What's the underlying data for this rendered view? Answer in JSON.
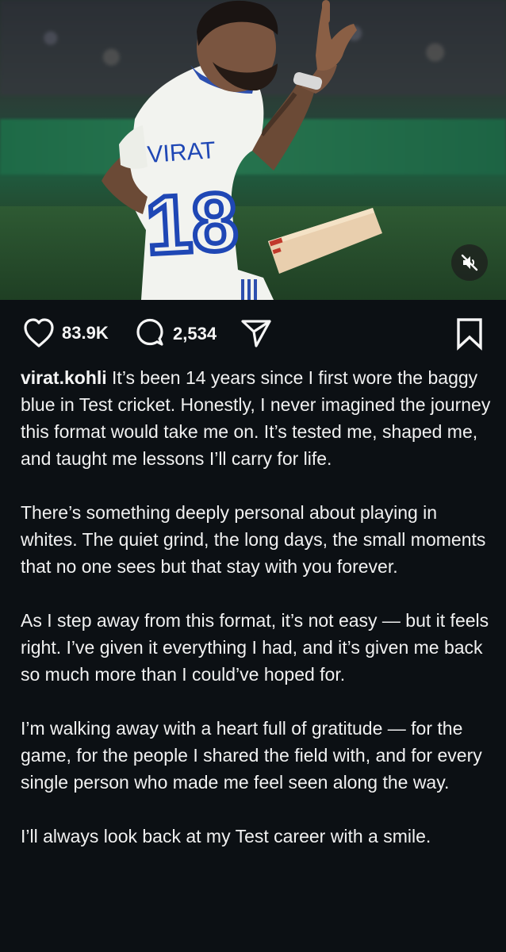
{
  "post": {
    "likes": "83.9K",
    "comments": "2,534"
  },
  "caption": {
    "username": "virat.kohli",
    "paragraphs": [
      "It’s been 14 years since I first wore the baggy blue in Test cricket. Honestly, I never imagined the journey this format would take me on. It’s tested me, shaped me, and taught me lessons I’ll carry for life.",
      "There’s something deeply personal about playing in whites. The quiet grind, the long days, the small moments that no one sees but that stay with you forever.",
      "As I step away from this format, it’s not easy — but it feels right. I’ve given it everything I had, and it’s given me back so much more than I could’ve hoped for.",
      "I’m walking away with a heart full of gratitude — for the game, for the people I shared the field with, and for every single person who made me feel seen along the way.",
      "I’ll always look back at my Test career with a smile."
    ]
  },
  "jersey": {
    "name": "VIRAT",
    "number": "18"
  },
  "icons": {
    "like": "heart-icon",
    "comment": "comment-icon",
    "share": "share-icon",
    "save": "bookmark-icon",
    "mute": "speaker-muted-icon"
  },
  "colors": {
    "background": "#0c1014",
    "text": "#f5f5f5",
    "jersey": "#f2f3ef",
    "jersey_number": "#1f47b5"
  }
}
